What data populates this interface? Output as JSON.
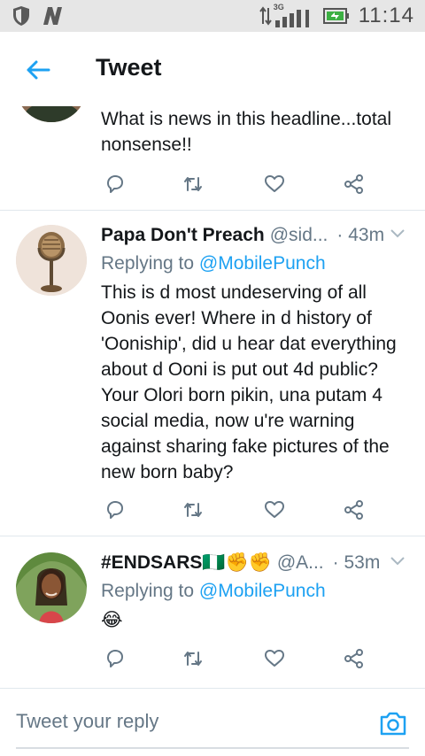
{
  "status_bar": {
    "network_type": "3G",
    "time": "11:14",
    "left_icons": [
      "shield-icon",
      "n-notification-icon"
    ],
    "right_icons": [
      "data-arrows-icon",
      "signal-icon",
      "battery-icon"
    ]
  },
  "header": {
    "title": "Tweet",
    "back_icon": "back-arrow-icon"
  },
  "tweets": [
    {
      "name": "",
      "handle": "",
      "time": "",
      "replying_to_prefix": "",
      "replying_to": "",
      "text": "What is news in this headline...total nonsense!!",
      "partial": true
    },
    {
      "name": "Papa Don't Preach",
      "handle": "@sid...",
      "time": "· 43m",
      "replying_to_prefix": "Replying to ",
      "replying_to": "@MobilePunch",
      "text": "This is d most undeserving of all Oonis ever! Where in d history of 'Ooniship', did u hear dat everything about d Ooni is put out 4d public? Your Olori born pikin, una putam 4 social media, now u're warning against sharing fake pictures of the new born baby?"
    },
    {
      "name": "#ENDSARS🇳🇬✊✊",
      "handle": "@A...",
      "time": "· 53m",
      "replying_to_prefix": "Replying to ",
      "replying_to": "@MobilePunch",
      "text": "😂"
    }
  ],
  "actions": [
    "reply-icon",
    "retweet-icon",
    "like-icon",
    "share-icon"
  ],
  "composer": {
    "placeholder": "Tweet your reply",
    "camera_icon": "camera-icon"
  },
  "colors": {
    "accent": "#1da1f2",
    "secondary_text": "#657786",
    "primary_text": "#14171a",
    "divider": "#e1e8ed",
    "status_bar_bg": "#e6e6e6"
  }
}
